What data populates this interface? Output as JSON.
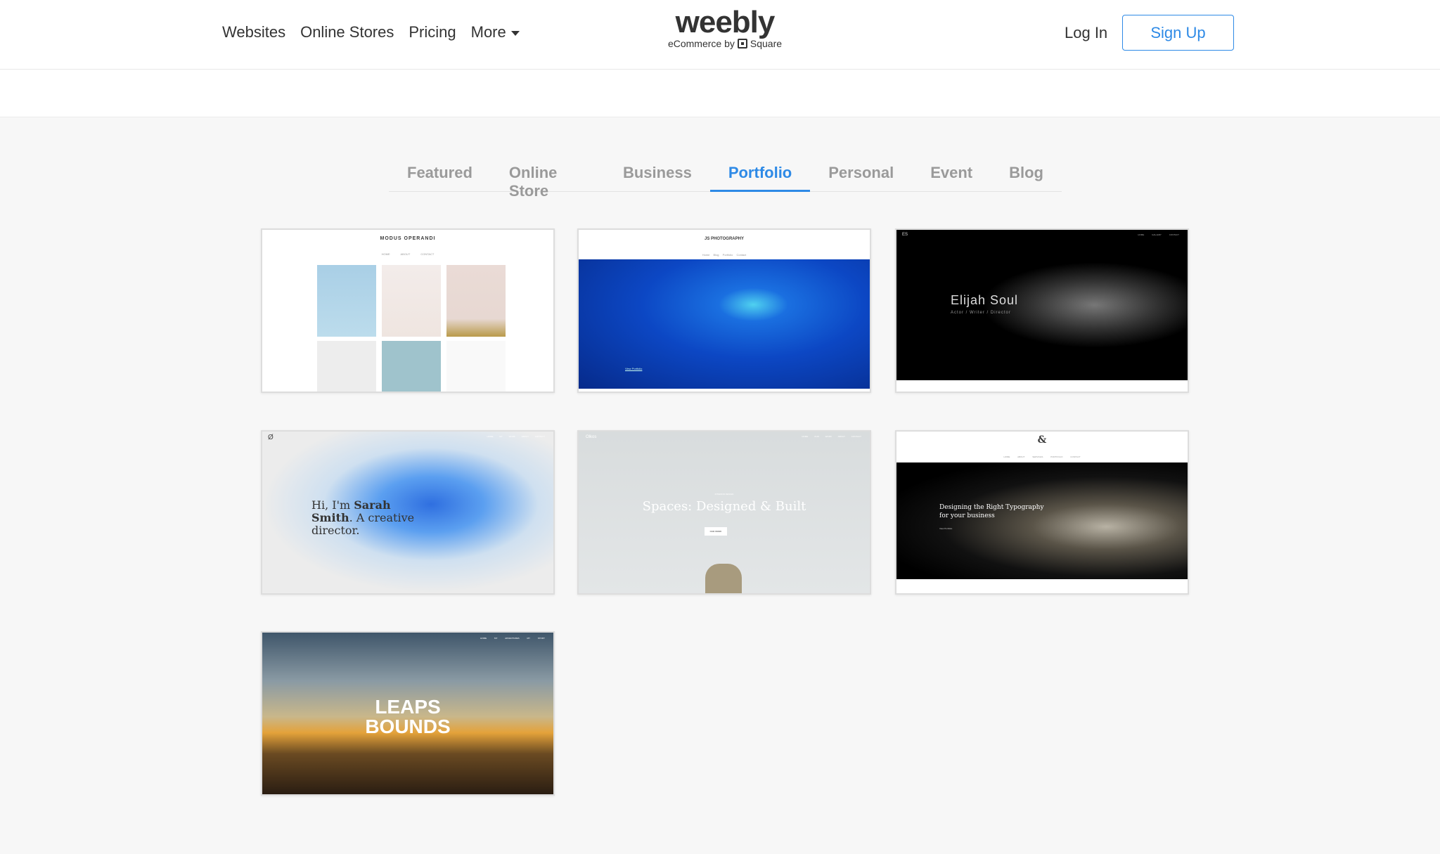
{
  "header": {
    "nav": [
      "Websites",
      "Online Stores",
      "Pricing",
      "More"
    ],
    "logo": {
      "word": "weebly",
      "sub": "eCommerce by",
      "brand": "Square"
    },
    "login": "Log In",
    "signup": "Sign Up"
  },
  "tabs": [
    {
      "label": "Featured"
    },
    {
      "label": "Online Store"
    },
    {
      "label": "Business"
    },
    {
      "label": "Portfolio",
      "active": true
    },
    {
      "label": "Personal"
    },
    {
      "label": "Event"
    },
    {
      "label": "Blog"
    }
  ],
  "accent": "#2e8ae6",
  "templates": [
    {
      "title": "MODUS OPERANDI",
      "nav": [
        "HOME",
        "ABOUT",
        "CONTACT"
      ]
    },
    {
      "title": "JS PHOTOGRAPHY",
      "nav": [
        "Home",
        "Blog",
        "Portfolio",
        "Contact"
      ],
      "link": "View Portfolio"
    },
    {
      "logo": "ES",
      "title": "Elijah Soul",
      "subtitle": "Actor / Writer / Director",
      "nav": [
        "HOME",
        "GALLERY",
        "CONTACT"
      ]
    },
    {
      "logo": "Ø",
      "title_a": "Hi, I'm ",
      "title_b": "Sarah Smith",
      "title_c": ". A creative director.",
      "nav": [
        "HOME",
        "MY WORK",
        "ABOUT",
        "CONTACT"
      ]
    },
    {
      "logo": "Olkos",
      "kicker": "INTERIOR DESIGN",
      "title": "Spaces: Designed & Built",
      "button": "OUR WORK",
      "nav": [
        "HOME",
        "OUR WORK",
        "ABOUT",
        "CONTACT"
      ]
    },
    {
      "logo": "&",
      "title": "Designing the Right Typography for your business",
      "link": "View Portfolio",
      "nav": [
        "HOME",
        "ABOUT",
        "SERVICES",
        "PORTFOLIO",
        "CONTACT"
      ]
    },
    {
      "title1": "LEAPS",
      "title2": "BOUNDS",
      "nav": [
        "HOME",
        "MY ADVENTURES",
        "MY STORY"
      ]
    }
  ]
}
